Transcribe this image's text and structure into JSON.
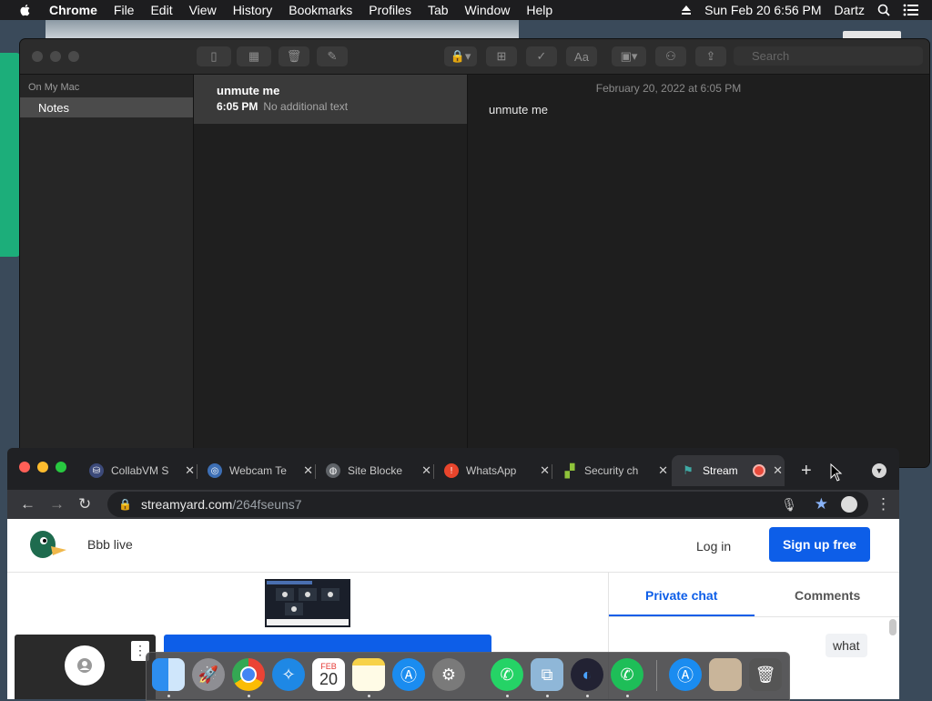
{
  "menubar": {
    "app": "Chrome",
    "items": [
      "File",
      "Edit",
      "View",
      "History",
      "Bookmarks",
      "Profiles",
      "Tab",
      "Window",
      "Help"
    ],
    "clock": "Sun Feb 20  6:56 PM",
    "user": "Dartz"
  },
  "notes": {
    "sidebar_header": "On My Mac",
    "sidebar_folder": "Notes",
    "search_placeholder": "Search",
    "note": {
      "title": "unmute me",
      "time": "6:05 PM",
      "preview": "No additional text"
    },
    "editor": {
      "date": "February 20, 2022 at 6:05 PM",
      "body": "unmute me"
    }
  },
  "chrome": {
    "tabs": [
      {
        "title": "CollabVM S",
        "icon": "collabvm-icon"
      },
      {
        "title": "Webcam Te",
        "icon": "webcam-icon"
      },
      {
        "title": "Site Blocke",
        "icon": "globe-icon"
      },
      {
        "title": "WhatsApp",
        "icon": "alert-icon"
      },
      {
        "title": "Security ch",
        "icon": "leaf-icon"
      },
      {
        "title": "Stream",
        "icon": "streamyard-icon",
        "active": true,
        "recording": true
      }
    ],
    "url_host": "streamyard.com",
    "url_path": "/264fseuns7"
  },
  "streamyard": {
    "broadcast_name": "Bbb live",
    "login": "Log in",
    "signup": "Sign up free",
    "chat_tabs": [
      "Private chat",
      "Comments"
    ],
    "chat_message": "what"
  },
  "dock": {
    "apps": [
      "finder",
      "launchpad",
      "chrome",
      "safari",
      "calendar",
      "notes",
      "app-store",
      "system-preferences",
      "whatsapp",
      "preview",
      "quicktime",
      "whatsapp-desktop",
      "app-store-downloads",
      "profile-photo",
      "trash"
    ],
    "calendar_month": "FEB",
    "calendar_day": "20"
  },
  "colors": {
    "accent_blue": "#0d5ee8",
    "notes_selected": "#4b4b4b",
    "menubar": "#1d1d1f"
  }
}
